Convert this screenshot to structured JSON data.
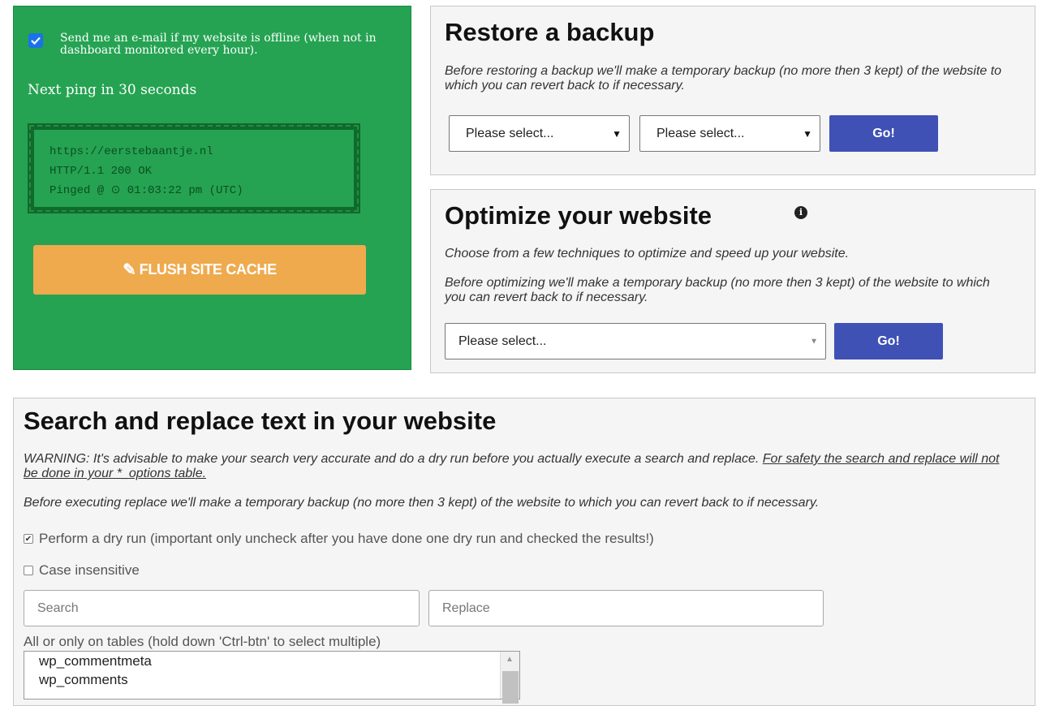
{
  "status": {
    "notify_label": "Send me an e-mail if my website is offline (when not in dashboard monitored every hour).",
    "notify_checked": true,
    "next_ping": "Next ping in 30 seconds",
    "ping": {
      "url": "https://eerstebaantje.nl",
      "response": "HTTP/1.1 200 OK",
      "pinged_prefix": "Pinged @",
      "time": "01:03:22 pm (UTC)"
    },
    "flush_label": "FLUSH SITE CACHE",
    "colors": {
      "panel": "#25a352",
      "flush": "#efaa4e"
    }
  },
  "restore": {
    "title": "Restore a backup",
    "description": "Before restoring a backup we'll make a temporary backup (no more then 3 kept) of the website to which you can revert back to if necessary.",
    "select1": "Please select...",
    "select2": "Please select...",
    "go_label": "Go!"
  },
  "optimize": {
    "title": "Optimize your website",
    "info_icon": "info-circle-icon",
    "description1": "Choose from a few techniques to optimize and speed up your website.",
    "description2": "Before optimizing we'll make a temporary backup (no more then 3 kept) of the website to which you can revert back to if necessary.",
    "select": "Please select...",
    "go_label": "Go!"
  },
  "search_replace": {
    "title": "Search and replace text in your website",
    "warning": "WARNING: It's advisable to make your search very accurate and do a dry run before you actually execute a search and replace.",
    "warning_link": "For safety the search and replace will not be done in your *_options table.",
    "backup_note": "Before executing replace we'll make a temporary backup (no more then 3 kept) of the website to which you can revert back to if necessary.",
    "dry_run_label": "Perform a dry run (important only uncheck after you have done one dry run and checked the results!)",
    "dry_run_checked": true,
    "case_label": "Case insensitive",
    "case_checked": false,
    "search_placeholder": "Search",
    "replace_placeholder": "Replace",
    "tables_label": "All or only on tables (hold down 'Ctrl-btn' to select multiple)",
    "tables": [
      "wp_commentmeta",
      "wp_comments"
    ]
  },
  "accent": "#3f51b5"
}
